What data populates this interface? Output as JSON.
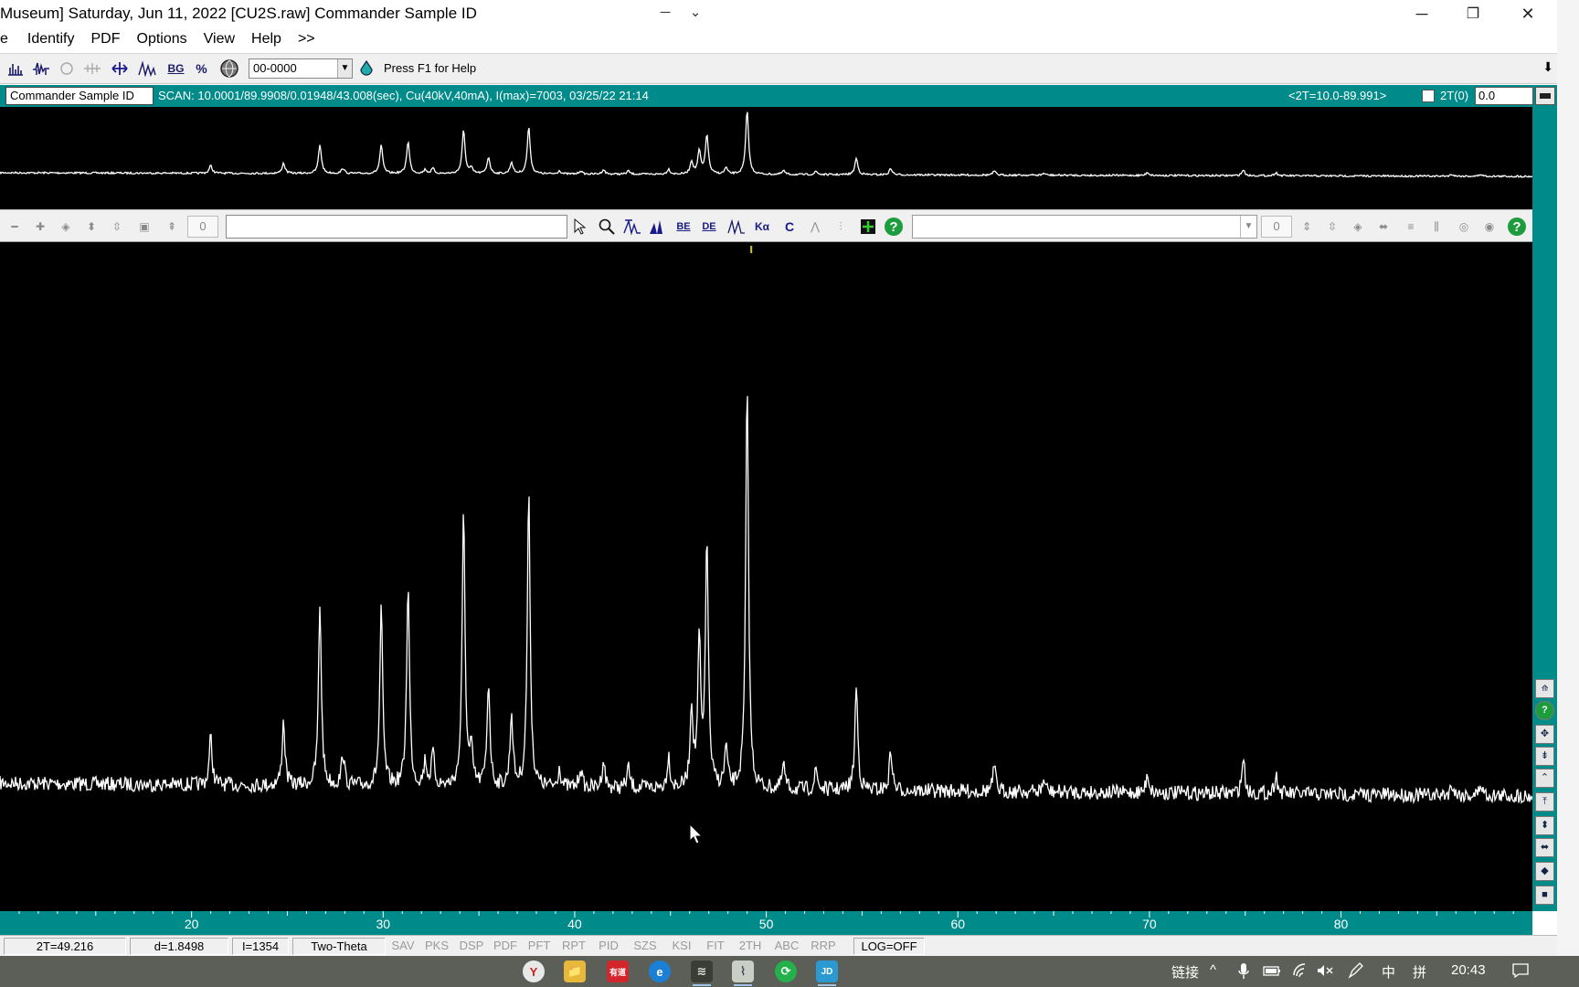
{
  "window": {
    "title": "Museum] Saturday, Jun 11, 2022 [CU2S.raw] Commander Sample ID",
    "minimize": "─",
    "restore": "❐",
    "close": "✕",
    "center_left": "─",
    "center_right": "⌄"
  },
  "menu": {
    "first": "e",
    "items": [
      "Identify",
      "PDF",
      "Options",
      "View",
      "Help",
      ">>"
    ]
  },
  "toolbar1": {
    "pdf_number": "00-0000",
    "help_text": "Press F1 for Help",
    "bg_label": "BG",
    "pct_label": "%"
  },
  "scanbar": {
    "sample_id": "Commander Sample ID",
    "scan_info": "SCAN: 10.0001/89.9908/0.01948/43.008(sec), Cu(40kV,40mA), I(max)=7003, 03/25/22 21:14",
    "range": "<2T=10.0-89.991>",
    "zero_label": "2T(0)",
    "zero_value": "0.0"
  },
  "toolbar2": {
    "left_value": "0",
    "right_value": "0",
    "labels": {
      "be": "BE",
      "de": "DE",
      "ka": "Kα",
      "c": "C"
    }
  },
  "chart_data": {
    "type": "line",
    "xlabel": "",
    "ylabel": "",
    "xlim": [
      10.0,
      89.991
    ],
    "x_ticks": [
      20,
      30,
      40,
      50,
      60,
      70,
      80
    ],
    "background": "#000000",
    "line_color": "#ffffff",
    "series": [
      {
        "peaks_2theta": [
          21.0,
          24.8,
          26.7,
          27.9,
          29.9,
          31.3,
          32.2,
          32.6,
          34.2,
          34.6,
          35.5,
          36.7,
          37.6,
          39.2,
          40.3,
          41.5,
          42.8,
          44.9,
          46.1,
          46.5,
          46.9,
          47.9,
          49.0,
          50.9,
          52.6,
          54.7,
          56.5,
          61.9,
          64.5,
          69.9,
          74.9,
          76.6,
          85.8,
          87.3
        ],
        "peaks_relative_intensity": [
          0.12,
          0.16,
          0.45,
          0.08,
          0.44,
          0.5,
          0.06,
          0.08,
          0.68,
          0.08,
          0.26,
          0.18,
          0.73,
          0.05,
          0.05,
          0.07,
          0.05,
          0.08,
          0.2,
          0.36,
          0.62,
          0.1,
          1.0,
          0.06,
          0.05,
          0.26,
          0.1,
          0.06,
          0.03,
          0.05,
          0.09,
          0.05,
          0.03,
          0.03
        ]
      }
    ]
  },
  "status": {
    "two_theta": "2T=49.216",
    "d_spacing": "d=1.8498",
    "intensity": "I=1354",
    "mode": "Two-Theta",
    "toggles": [
      "SAV",
      "PKS",
      "DSP",
      "PDF",
      "PFT",
      "RPT",
      "PID",
      "SZS",
      "KSI",
      "FIT",
      "2TH",
      "ABC",
      "RRP"
    ],
    "log": "LOG=OFF"
  },
  "taskbar": {
    "apps": [
      "Y",
      "📁",
      "有道",
      "e",
      "≋",
      "⌇",
      "⟳",
      "JD"
    ],
    "tray_link": "链接",
    "ime": "中",
    "ime2": "拼",
    "clock": "20:43"
  },
  "colors": {
    "teal": "#008b8b",
    "plot_bg": "#000000",
    "trace": "#ffffff"
  }
}
